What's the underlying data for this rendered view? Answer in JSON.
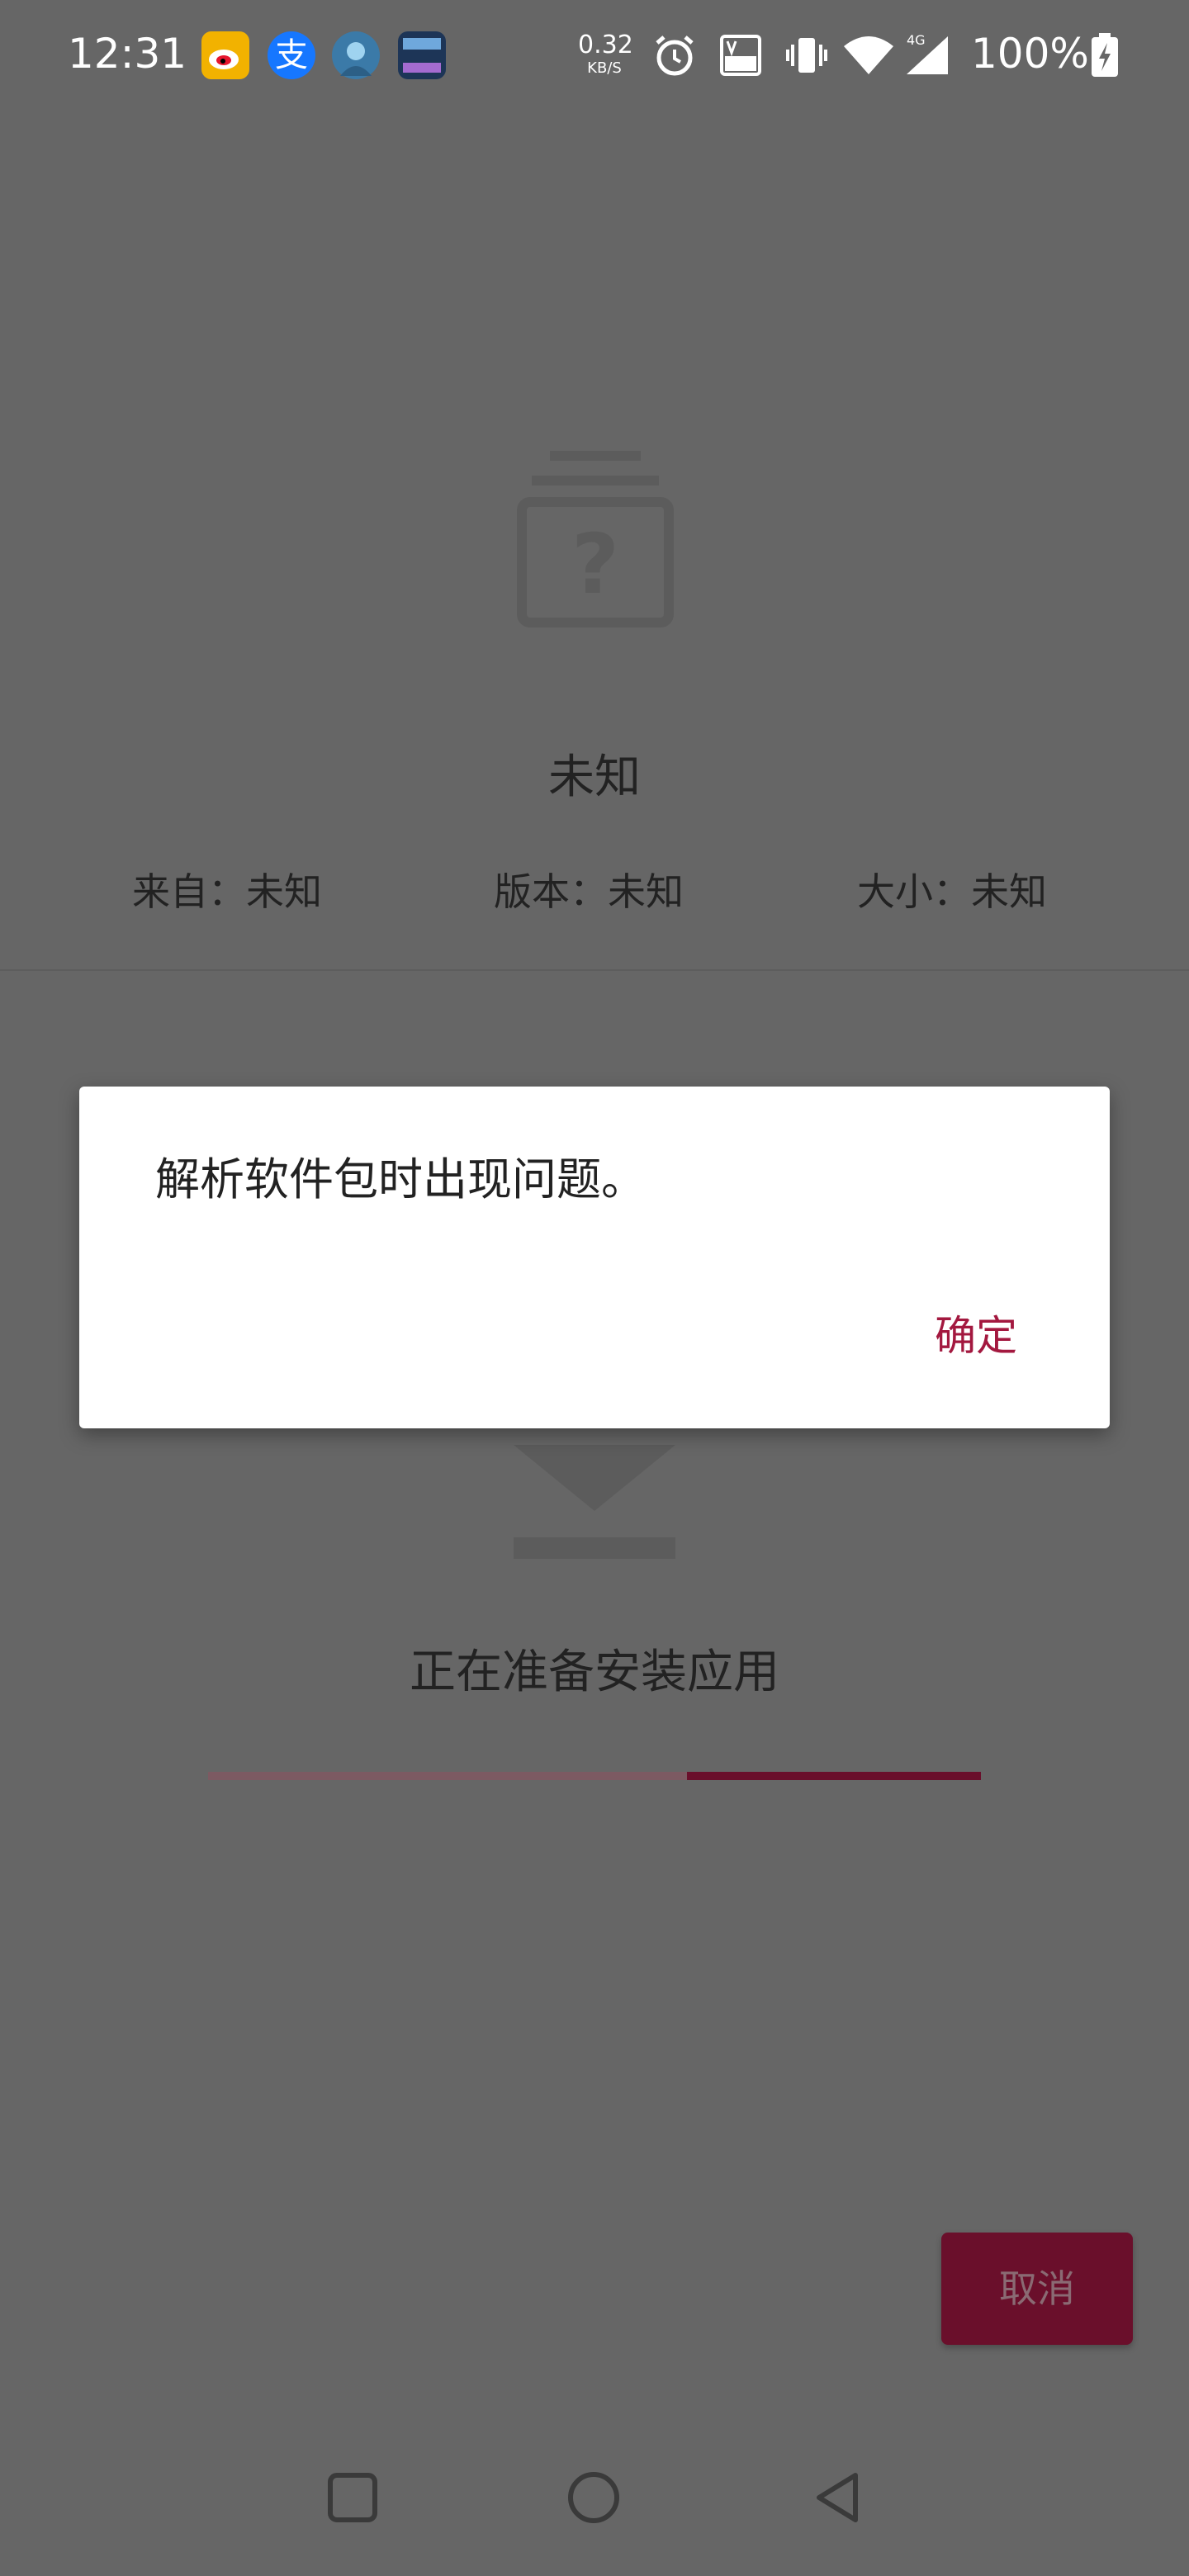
{
  "status_bar": {
    "time": "12:31",
    "net_speed_value": "0.32",
    "net_speed_unit": "KB/S",
    "battery": "100%",
    "notification_icons": [
      "weibo-icon",
      "alipay-icon",
      "game-avatar-icon",
      "game-app-icon"
    ],
    "alipay_glyph": "支",
    "status_icons": [
      "alarm-icon",
      "volte-icon",
      "vibrate-icon",
      "wifi-icon",
      "signal-4g-icon",
      "battery-charging-icon"
    ]
  },
  "package": {
    "name": "未知",
    "from": "来自：未知",
    "version": "版本：未知",
    "size": "大小：未知"
  },
  "install": {
    "status_text": "正在准备安装应用",
    "cancel_label": "取消",
    "progress_segment_start": 0.62,
    "progress_segment_end": 1.0
  },
  "dialog": {
    "message": "解析软件包时出现问题。",
    "ok_label": "确定"
  },
  "nav_bar": {
    "buttons": [
      "recents-button",
      "home-button",
      "back-button"
    ]
  },
  "colors": {
    "scrim": "#666666",
    "accent": "#a3183f",
    "accent_dark": "#6a0f2b"
  }
}
